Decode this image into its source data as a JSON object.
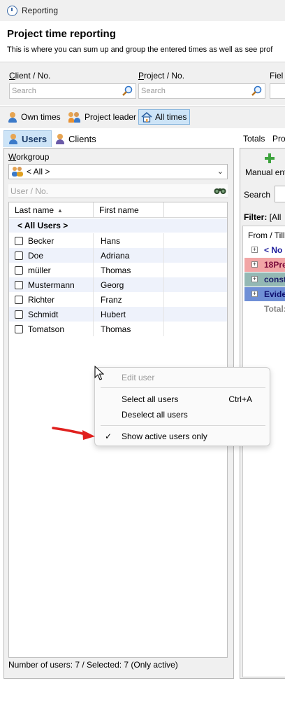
{
  "window": {
    "title": "Reporting"
  },
  "header": {
    "title": "Project time reporting",
    "description": "This is where you can sum up and group the entered times as well as see prof"
  },
  "search_fields": [
    {
      "label_u": "C",
      "label_rest": "lient / No.",
      "placeholder": "Search"
    },
    {
      "label_u": "P",
      "label_rest": "roject / No.",
      "placeholder": "Search"
    },
    {
      "label_u": "",
      "label_rest": "Fiel",
      "placeholder": ""
    }
  ],
  "report_tabs": {
    "own": "Own times",
    "leader": "Project leader",
    "all": "All times",
    "active": "all"
  },
  "subtabs": {
    "users": "Users",
    "clients": "Clients"
  },
  "workgroup": {
    "label_u": "W",
    "label_rest": "orkgroup",
    "selected": "< All >",
    "filter_placeholder": "User / No."
  },
  "users_table": {
    "columns": {
      "last_name": "Last name",
      "first_name": "First name"
    },
    "all_row": "< All Users >",
    "rows": [
      {
        "last": "Becker",
        "first": "Hans"
      },
      {
        "last": "Doe",
        "first": "Adriana"
      },
      {
        "last": "müller",
        "first": "Thomas"
      },
      {
        "last": "Mustermann",
        "first": "Georg"
      },
      {
        "last": "Richter",
        "first": "Franz"
      },
      {
        "last": "Schmidt",
        "first": "Hubert"
      },
      {
        "last": "Tomatson",
        "first": "Thomas"
      }
    ]
  },
  "status": "Number of users: 7 / Selected: 7 (Only active)",
  "right_pane": {
    "tab_totals": "Totals",
    "tab_pro": "Pro",
    "manual": "Manual ent",
    "search_label": "Search",
    "filter_label": "Filter:",
    "filter_value": "[All",
    "tree_header": "From / Till",
    "nodes": [
      {
        "text": "< No a",
        "bg": "#ffffff",
        "color": "#1a1a9a"
      },
      {
        "text": "18Pre",
        "bg": "#f2a5a5",
        "color": "#7a0a3a"
      },
      {
        "text": "constr",
        "bg": "#93b8b4",
        "color": "#1a1a6a"
      },
      {
        "text": "Evider",
        "bg": "#6f8fd6",
        "color": "#101070"
      }
    ],
    "total": "Total:"
  },
  "context_menu": {
    "edit": "Edit user",
    "select_all": "Select all users",
    "select_all_shortcut": "Ctrl+A",
    "deselect_all": "Deselect all users",
    "show_active": "Show active users only",
    "check_glyph": "✓"
  },
  "colors": {
    "accent_selected": "#cde4f7",
    "annotation_arrow": "#e0201e"
  }
}
